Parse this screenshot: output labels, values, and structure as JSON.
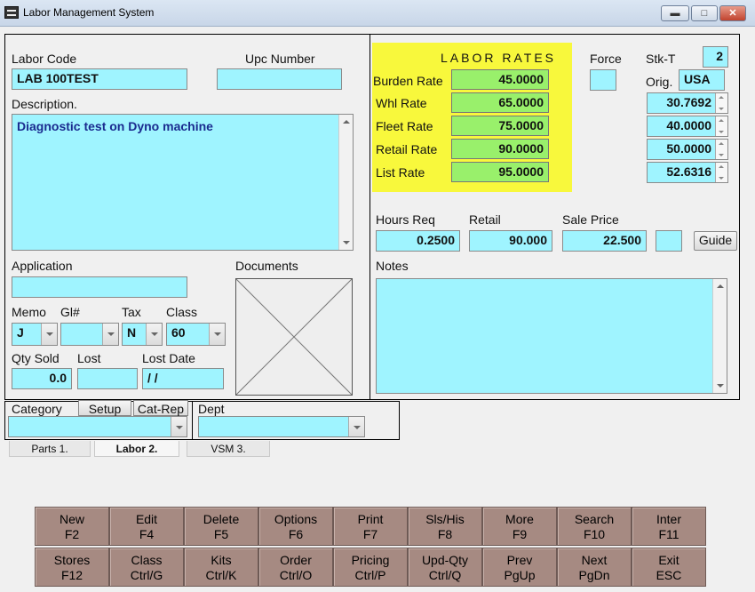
{
  "window": {
    "title": "Labor Management System"
  },
  "labor": {
    "code_label": "Labor Code",
    "code_value": "LAB 100TEST",
    "upc_label": "Upc  Number",
    "upc_value": "",
    "description_label": "Description.",
    "description_value": "Diagnostic test on Dyno machine",
    "application_label": "Application",
    "application_value": "",
    "documents_label": "Documents",
    "memo_label": "Memo",
    "memo_value": "J",
    "gl_label": "Gl#",
    "gl_value": "",
    "tax_label": "Tax",
    "tax_value": "N",
    "class_label": "Class",
    "class_value": "60",
    "qty_sold_label": "Qty Sold",
    "qty_sold_value": "0.0",
    "lost_label": "Lost",
    "lost_value": "",
    "lost_date_label": "Lost Date",
    "lost_date_value": " /  /"
  },
  "rates": {
    "header": "LABOR RATES",
    "force_label": "Force",
    "stkt_label": "Stk-T",
    "stkt_value": "2",
    "orig_label": "Orig.",
    "orig_value": "USA",
    "rows": [
      {
        "label": "Burden Rate",
        "value": "45.0000",
        "pct": "30.7692"
      },
      {
        "label": "Whl Rate",
        "value": "65.0000",
        "pct": "40.0000"
      },
      {
        "label": "Fleet Rate",
        "value": "75.0000",
        "pct": "50.0000"
      },
      {
        "label": "Retail Rate",
        "value": "90.0000",
        "pct": "52.6316"
      },
      {
        "label": "List Rate",
        "value": "95.0000"
      }
    ]
  },
  "pricing": {
    "hours_req_label": "Hours Req",
    "hours_req_value": "0.2500",
    "retail_label": "Retail",
    "retail_value": "90.000",
    "sale_price_label": "Sale Price",
    "sale_price_value": "22.500",
    "guide_label": "Guide",
    "notes_label": "Notes",
    "notes_value": ""
  },
  "category": {
    "category_label": "Category",
    "setup_label": "Setup",
    "catrep_label": "Cat-Rep",
    "dept_label": "Dept",
    "category_value": "",
    "dept_value": ""
  },
  "tabs": [
    {
      "label": "Parts 1."
    },
    {
      "label": "Labor 2."
    },
    {
      "label": "VSM 3."
    }
  ],
  "fkeys_row1": [
    {
      "name": "New",
      "key": "F2"
    },
    {
      "name": "Edit",
      "key": "F4"
    },
    {
      "name": "Delete",
      "key": "F5"
    },
    {
      "name": "Options",
      "key": "F6"
    },
    {
      "name": "Print",
      "key": "F7"
    },
    {
      "name": "Sls/His",
      "key": "F8"
    },
    {
      "name": "More",
      "key": "F9"
    },
    {
      "name": "Search",
      "key": "F10"
    },
    {
      "name": "Inter",
      "key": "F11"
    }
  ],
  "fkeys_row2": [
    {
      "name": "Stores",
      "key": "F12"
    },
    {
      "name": "Class",
      "key": "Ctrl/G"
    },
    {
      "name": "Kits",
      "key": "Ctrl/K"
    },
    {
      "name": "Order",
      "key": "Ctrl/O"
    },
    {
      "name": "Pricing",
      "key": "Ctrl/P"
    },
    {
      "name": "Upd-Qty",
      "key": "Ctrl/Q"
    },
    {
      "name": "Prev",
      "key": "PgUp"
    },
    {
      "name": "Next",
      "key": "PgDn"
    },
    {
      "name": "Exit",
      "key": "ESC"
    }
  ],
  "colors": {
    "field": "#9ff4ff",
    "rate_field": "#99f06b",
    "rates_box": "#f8f83c",
    "fkey": "#a68a82"
  }
}
